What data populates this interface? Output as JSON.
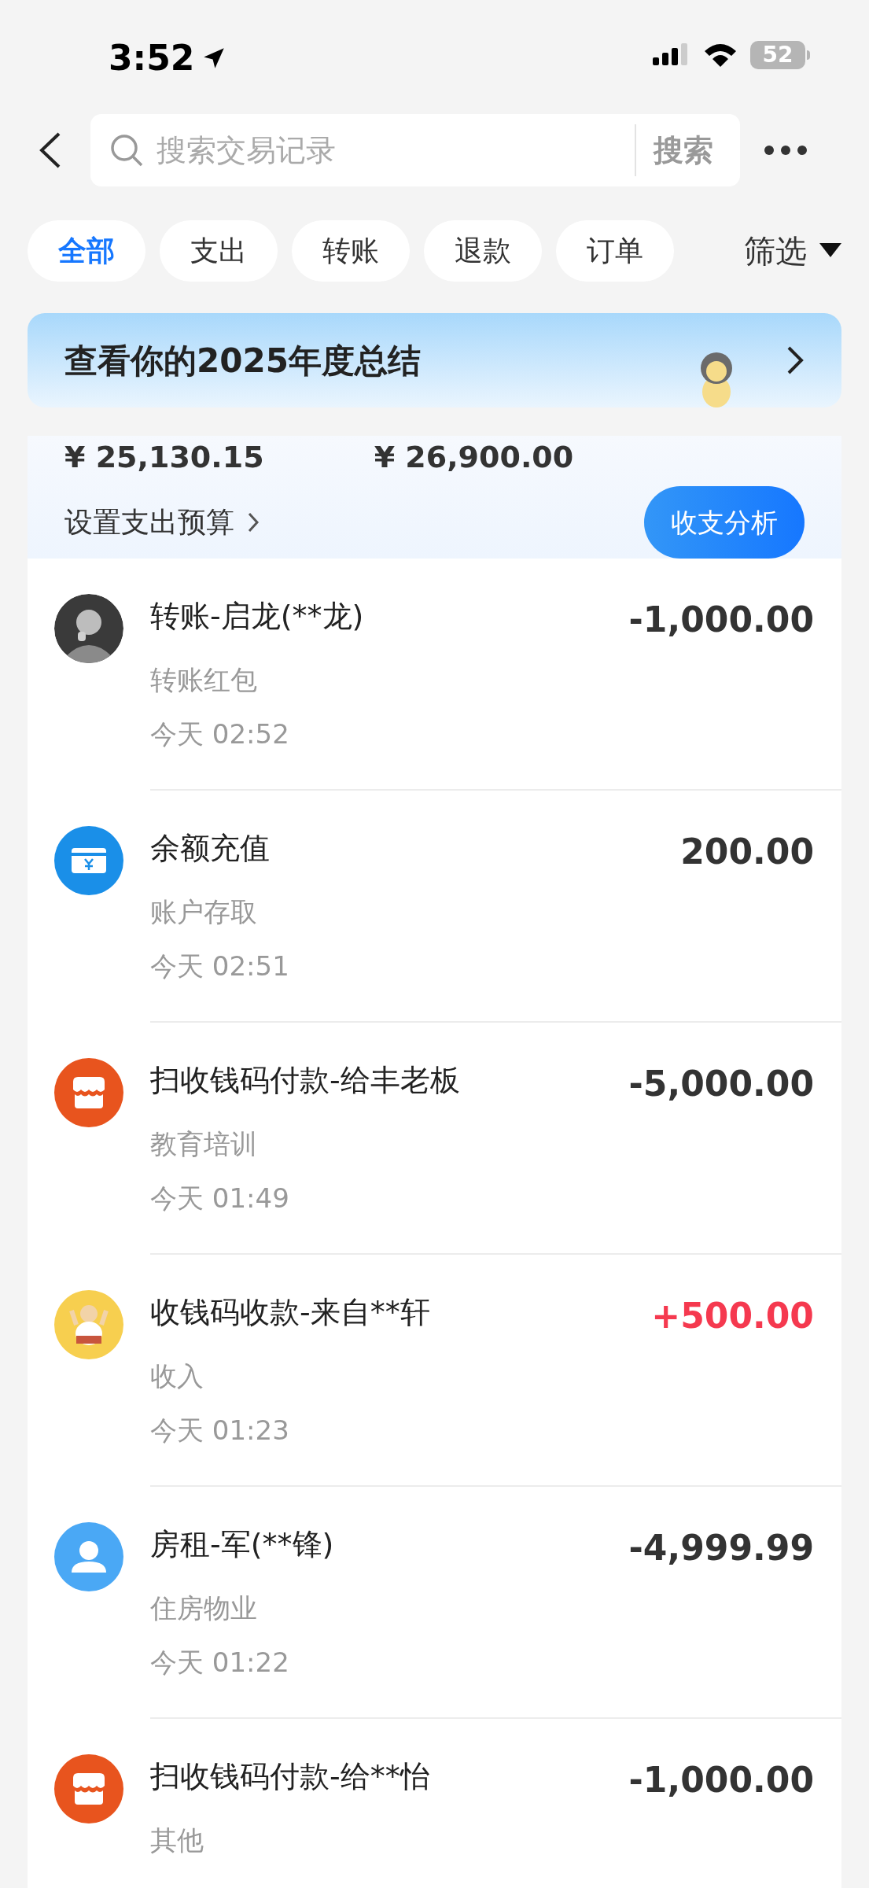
{
  "status_bar": {
    "time": "3:52",
    "battery": "52"
  },
  "header": {
    "search": {
      "placeholder": "搜索交易记录"
    },
    "search_button": "搜索"
  },
  "chips": [
    {
      "label": "全部",
      "selected": true
    },
    {
      "label": "支出",
      "selected": false
    },
    {
      "label": "转账",
      "selected": false
    },
    {
      "label": "退款",
      "selected": false
    },
    {
      "label": "订单",
      "selected": false
    }
  ],
  "filter": "筛选",
  "banner": {
    "title": "查看你的2025年度总结"
  },
  "summary": {
    "amounts": [
      "¥ 25,130.15",
      "¥ 26,900.00"
    ],
    "budget_link": "设置支出预算",
    "analysis_button": "收支分析"
  },
  "transactions": [
    {
      "title": "转账-启龙(**龙)",
      "category": "转账红包",
      "time": "今天 02:52",
      "amount": "-1,000.00",
      "income": false
    },
    {
      "kind": "wallet",
      "title": "余额充值",
      "category": "账户存取",
      "time": "今天 02:51",
      "amount": "200.00",
      "income": false
    },
    {
      "kind": "shop",
      "title": "扫收钱码付款-给丰老板",
      "category": "教育培训",
      "time": "今天 01:49",
      "amount": "-5,000.00",
      "income": false
    },
    {
      "kind": "cartoon",
      "title": "收钱码收款-来自**轩",
      "category": "收入",
      "time": "今天 01:23",
      "amount": "+500.00",
      "income": true
    },
    {
      "kind": "person",
      "title": "房租-军(**锋)",
      "category": "住房物业",
      "time": "今天 01:22",
      "amount": "-4,999.99",
      "income": false
    },
    {
      "kind": "shop",
      "title": "扫收钱码付款-给**怡",
      "category": "其他",
      "amount": "-1,000.00",
      "income": false
    }
  ]
}
